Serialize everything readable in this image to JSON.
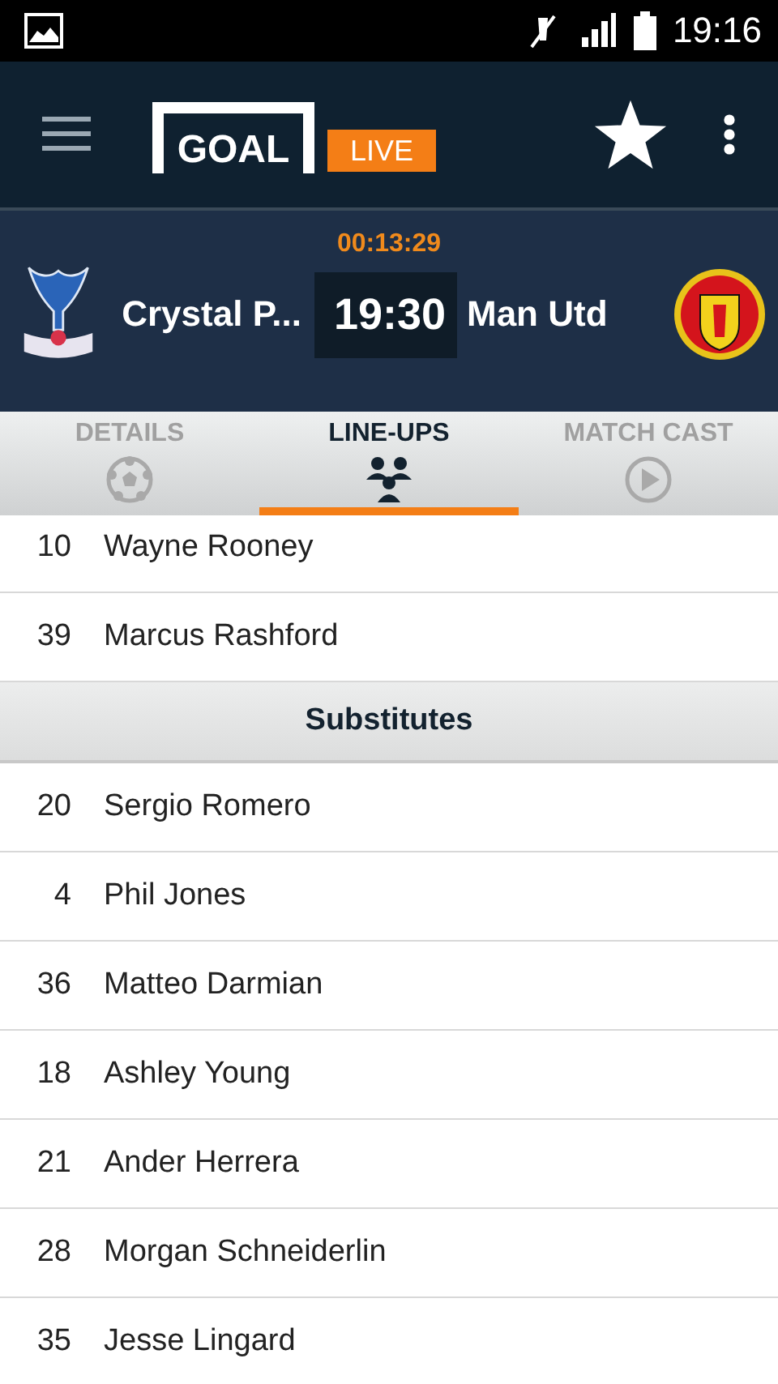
{
  "status_bar": {
    "time": "19:16"
  },
  "app_bar": {
    "logo": "GOAL",
    "badge": "LIVE"
  },
  "match": {
    "clock": "00:13:29",
    "home": "Crystal P...",
    "score": "19:30",
    "away": "Man Utd"
  },
  "tabs": [
    {
      "label": "DETAILS",
      "kind": "ball",
      "selected": false
    },
    {
      "label": "LINE-UPS",
      "kind": "people",
      "selected": true
    },
    {
      "label": "MATCH CAST",
      "kind": "play",
      "selected": false
    }
  ],
  "rows": [
    {
      "kind": "player",
      "number": "10",
      "name": "Wayne Rooney"
    },
    {
      "kind": "player",
      "number": "39",
      "name": "Marcus Rashford"
    },
    {
      "kind": "header",
      "name": "Substitutes"
    },
    {
      "kind": "player",
      "number": "20",
      "name": "Sergio Romero"
    },
    {
      "kind": "player",
      "number": "4",
      "name": "Phil Jones"
    },
    {
      "kind": "player",
      "number": "36",
      "name": "Matteo Darmian"
    },
    {
      "kind": "player",
      "number": "18",
      "name": "Ashley Young"
    },
    {
      "kind": "player",
      "number": "21",
      "name": "Ander Herrera"
    },
    {
      "kind": "player",
      "number": "28",
      "name": "Morgan Schneiderlin"
    },
    {
      "kind": "player",
      "number": "35",
      "name": "Jesse Lingard"
    }
  ]
}
